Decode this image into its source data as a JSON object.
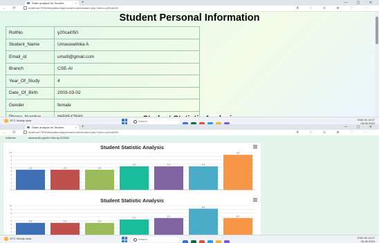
{
  "browser": {
    "tab_title": "Static analysis for Student",
    "tab_close": "×",
    "new_tab": "+",
    "url": "localhost:7990/integration/app/student-info/student.php?rollno=y20cai050",
    "nav": "←  ⟳",
    "tools": "A  ☆  ⊙  ⊕  ♡  ⋯",
    "window_controls": "—  ▢  ✕"
  },
  "top_screenshot": {
    "page_title": "Student Personal Information",
    "rows": [
      {
        "label": "RollNo",
        "value": "y20cai050"
      },
      {
        "label": "Student_Name",
        "value": "Umaswathika A"
      },
      {
        "label": "Email_id",
        "value": "uma9@gmail.com"
      },
      {
        "label": "Branch",
        "value": "CSE-AI"
      },
      {
        "label": "Year_Of_Study",
        "value": "4"
      },
      {
        "label": "Date_Of_Birth",
        "value": "2003-03-02"
      },
      {
        "label": "Gender",
        "value": "female"
      },
      {
        "label": "Phone_Number",
        "value": "9658547569"
      },
      {
        "label": "Address",
        "value": "amaravathi,guntur dist,ap-522002"
      }
    ],
    "next_section_heading": "Student Statistic Analysis"
  },
  "bottom_screenshot": {
    "address_row_label": "Address",
    "address_row_value": "amaravathi,guntur dist,ap-522002"
  },
  "taskbar": {
    "weather_temp": "25°C",
    "weather_desc": "Mostly clear",
    "search_placeholder": "Search",
    "time": "19:27",
    "date": "26-06-2024",
    "lang": "ENG IN",
    "app_colors": [
      "#3b6fd9",
      "#0b6a3c",
      "#e04d3a",
      "#2a9be3",
      "#f2b233",
      "#7a5ad8"
    ]
  },
  "colors": {
    "page_bg": "#e0f7ee",
    "table_border": "#9fc5a8",
    "bar_palette": [
      "#3f6fb5",
      "#c0504d",
      "#9bbb59",
      "#1abc9c",
      "#8064a2",
      "#4aacc6",
      "#f79646"
    ]
  },
  "chart_data": [
    {
      "type": "bar",
      "title": "Student Statistic Analysis",
      "categories": [
        "",
        "",
        "",
        "",
        "",
        "",
        ""
      ],
      "values": [
        5.4,
        5.4,
        5.4,
        6.3,
        6.3,
        6.3,
        9.4
      ],
      "ylim": [
        0,
        10
      ],
      "yticks": [
        0,
        1,
        2,
        3,
        4,
        5,
        6,
        7,
        8,
        9,
        10
      ],
      "grid": true,
      "legend": "none"
    },
    {
      "type": "bar",
      "title": "Student Statistic Analysis",
      "categories": [
        "",
        "",
        "",
        "",
        "",
        "",
        ""
      ],
      "values": [
        5.4,
        5.4,
        5.4,
        6.3,
        6.7,
        9.2,
        6.7
      ],
      "ylim": [
        0,
        10
      ],
      "yticks": [
        0,
        1,
        2,
        3,
        4,
        5,
        6,
        7,
        8,
        9,
        10
      ],
      "grid": true,
      "legend": "none"
    }
  ]
}
